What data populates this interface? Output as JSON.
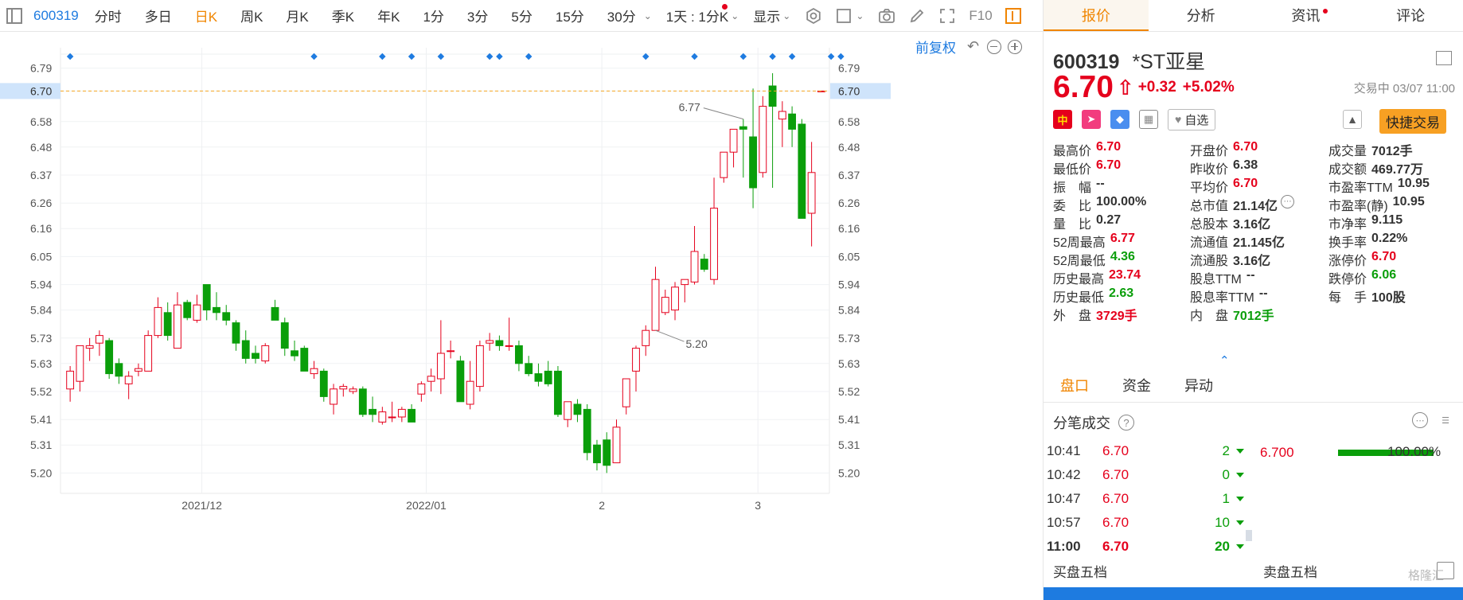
{
  "toolbar": {
    "code": "600319",
    "periods": [
      "分时",
      "多日",
      "日K",
      "周K",
      "月K",
      "季K",
      "年K",
      "1分",
      "3分",
      "5分",
      "15分",
      "30分"
    ],
    "active_period": "日K",
    "interval_label": "1天 : 1分K",
    "display_label": "显示",
    "f10_label": "F10"
  },
  "chart_controls": {
    "adjust_label": "前复权"
  },
  "chart_data": {
    "type": "candlestick",
    "y_ticks": [
      6.79,
      6.7,
      6.58,
      6.48,
      6.37,
      6.26,
      6.16,
      6.05,
      5.94,
      5.84,
      5.73,
      5.63,
      5.52,
      5.41,
      5.31,
      5.2
    ],
    "x_labels": [
      {
        "label": "2021/12",
        "index": 14
      },
      {
        "label": "2022/01",
        "index": 37
      },
      {
        "label": "2",
        "index": 55
      },
      {
        "label": "3",
        "index": 71
      }
    ],
    "ylim": [
      5.12,
      6.87
    ],
    "current_price": 6.7,
    "current_price_label": "6.70",
    "max_label": "6.77",
    "min_label": "5.20",
    "max_index": 69,
    "min_index": 60,
    "event_marker_indices": [
      0,
      25,
      32,
      35,
      38,
      43,
      44,
      47,
      59,
      64,
      69,
      72,
      74,
      78,
      79
    ],
    "candles": [
      {
        "o": 5.53,
        "h": 5.62,
        "l": 5.48,
        "c": 5.6
      },
      {
        "o": 5.56,
        "h": 5.7,
        "l": 5.52,
        "c": 5.7
      },
      {
        "o": 5.69,
        "h": 5.73,
        "l": 5.64,
        "c": 5.7
      },
      {
        "o": 5.71,
        "h": 5.76,
        "l": 5.66,
        "c": 5.74
      },
      {
        "o": 5.72,
        "h": 5.73,
        "l": 5.57,
        "c": 5.59
      },
      {
        "o": 5.63,
        "h": 5.65,
        "l": 5.55,
        "c": 5.58
      },
      {
        "o": 5.55,
        "h": 5.6,
        "l": 5.49,
        "c": 5.58
      },
      {
        "o": 5.6,
        "h": 5.63,
        "l": 5.58,
        "c": 5.61
      },
      {
        "o": 5.6,
        "h": 5.76,
        "l": 5.6,
        "c": 5.74
      },
      {
        "o": 5.74,
        "h": 5.89,
        "l": 5.73,
        "c": 5.85
      },
      {
        "o": 5.83,
        "h": 5.87,
        "l": 5.72,
        "c": 5.74
      },
      {
        "o": 5.69,
        "h": 5.91,
        "l": 5.69,
        "c": 5.86
      },
      {
        "o": 5.87,
        "h": 5.88,
        "l": 5.8,
        "c": 5.81
      },
      {
        "o": 5.8,
        "h": 5.9,
        "l": 5.79,
        "c": 5.86
      },
      {
        "o": 5.94,
        "h": 5.94,
        "l": 5.8,
        "c": 5.84
      },
      {
        "o": 5.85,
        "h": 5.91,
        "l": 5.8,
        "c": 5.83
      },
      {
        "o": 5.83,
        "h": 5.86,
        "l": 5.78,
        "c": 5.8
      },
      {
        "o": 5.79,
        "h": 5.8,
        "l": 5.68,
        "c": 5.71
      },
      {
        "o": 5.72,
        "h": 5.76,
        "l": 5.63,
        "c": 5.65
      },
      {
        "o": 5.67,
        "h": 5.7,
        "l": 5.63,
        "c": 5.65
      },
      {
        "o": 5.64,
        "h": 5.71,
        "l": 5.63,
        "c": 5.7
      },
      {
        "o": 5.85,
        "h": 5.88,
        "l": 5.8,
        "c": 5.8
      },
      {
        "o": 5.79,
        "h": 5.81,
        "l": 5.66,
        "c": 5.69
      },
      {
        "o": 5.68,
        "h": 5.72,
        "l": 5.64,
        "c": 5.66
      },
      {
        "o": 5.69,
        "h": 5.7,
        "l": 5.6,
        "c": 5.6
      },
      {
        "o": 5.59,
        "h": 5.64,
        "l": 5.57,
        "c": 5.61
      },
      {
        "o": 5.6,
        "h": 5.61,
        "l": 5.48,
        "c": 5.5
      },
      {
        "o": 5.47,
        "h": 5.55,
        "l": 5.43,
        "c": 5.53
      },
      {
        "o": 5.53,
        "h": 5.55,
        "l": 5.5,
        "c": 5.54
      },
      {
        "o": 5.52,
        "h": 5.54,
        "l": 5.51,
        "c": 5.53
      },
      {
        "o": 5.53,
        "h": 5.54,
        "l": 5.42,
        "c": 5.43
      },
      {
        "o": 5.45,
        "h": 5.5,
        "l": 5.4,
        "c": 5.43
      },
      {
        "o": 5.4,
        "h": 5.46,
        "l": 5.39,
        "c": 5.44
      },
      {
        "o": 5.42,
        "h": 5.48,
        "l": 5.4,
        "c": 5.42
      },
      {
        "o": 5.42,
        "h": 5.46,
        "l": 5.4,
        "c": 5.45
      },
      {
        "o": 5.45,
        "h": 5.47,
        "l": 5.41,
        "c": 5.4
      },
      {
        "o": 5.51,
        "h": 5.56,
        "l": 5.48,
        "c": 5.55
      },
      {
        "o": 5.56,
        "h": 5.61,
        "l": 5.52,
        "c": 5.58
      },
      {
        "o": 5.57,
        "h": 5.8,
        "l": 5.51,
        "c": 5.67
      },
      {
        "o": 5.68,
        "h": 5.72,
        "l": 5.65,
        "c": 5.68
      },
      {
        "o": 5.64,
        "h": 5.66,
        "l": 5.48,
        "c": 5.48
      },
      {
        "o": 5.47,
        "h": 5.64,
        "l": 5.45,
        "c": 5.56
      },
      {
        "o": 5.54,
        "h": 5.72,
        "l": 5.52,
        "c": 5.7
      },
      {
        "o": 5.71,
        "h": 5.75,
        "l": 5.68,
        "c": 5.72
      },
      {
        "o": 5.72,
        "h": 5.74,
        "l": 5.68,
        "c": 5.7
      },
      {
        "o": 5.7,
        "h": 5.81,
        "l": 5.68,
        "c": 5.7
      },
      {
        "o": 5.7,
        "h": 5.72,
        "l": 5.6,
        "c": 5.63
      },
      {
        "o": 5.63,
        "h": 5.66,
        "l": 5.58,
        "c": 5.59
      },
      {
        "o": 5.59,
        "h": 5.63,
        "l": 5.54,
        "c": 5.56
      },
      {
        "o": 5.6,
        "h": 5.64,
        "l": 5.54,
        "c": 5.55
      },
      {
        "o": 5.6,
        "h": 5.62,
        "l": 5.42,
        "c": 5.43
      },
      {
        "o": 5.41,
        "h": 5.48,
        "l": 5.38,
        "c": 5.48
      },
      {
        "o": 5.47,
        "h": 5.49,
        "l": 5.4,
        "c": 5.43
      },
      {
        "o": 5.45,
        "h": 5.47,
        "l": 5.25,
        "c": 5.28
      },
      {
        "o": 5.31,
        "h": 5.33,
        "l": 5.21,
        "c": 5.24
      },
      {
        "o": 5.33,
        "h": 5.36,
        "l": 5.2,
        "c": 5.23
      },
      {
        "o": 5.24,
        "h": 5.41,
        "l": 5.24,
        "c": 5.38
      },
      {
        "o": 5.46,
        "h": 5.57,
        "l": 5.43,
        "c": 5.57
      },
      {
        "o": 5.6,
        "h": 5.7,
        "l": 5.52,
        "c": 5.69
      },
      {
        "o": 5.7,
        "h": 5.78,
        "l": 5.66,
        "c": 5.76
      },
      {
        "o": 5.76,
        "h": 6.01,
        "l": 5.76,
        "c": 5.96
      },
      {
        "o": 5.83,
        "h": 5.92,
        "l": 5.82,
        "c": 5.89
      },
      {
        "o": 5.84,
        "h": 5.95,
        "l": 5.8,
        "c": 5.93
      },
      {
        "o": 5.94,
        "h": 5.95,
        "l": 5.87,
        "c": 5.96
      },
      {
        "o": 5.95,
        "h": 6.17,
        "l": 5.94,
        "c": 6.07
      },
      {
        "o": 6.04,
        "h": 6.06,
        "l": 5.99,
        "c": 6.0
      },
      {
        "o": 5.96,
        "h": 6.36,
        "l": 5.94,
        "c": 6.24
      },
      {
        "o": 6.36,
        "h": 6.45,
        "l": 6.34,
        "c": 6.46
      },
      {
        "o": 6.46,
        "h": 6.54,
        "l": 6.4,
        "c": 6.55
      },
      {
        "o": 6.56,
        "h": 6.59,
        "l": 6.36,
        "c": 6.55
      },
      {
        "o": 6.52,
        "h": 6.71,
        "l": 6.24,
        "c": 6.32
      },
      {
        "o": 6.38,
        "h": 6.68,
        "l": 6.36,
        "c": 6.64
      },
      {
        "o": 6.72,
        "h": 6.77,
        "l": 6.32,
        "c": 6.64
      },
      {
        "o": 6.59,
        "h": 6.66,
        "l": 6.48,
        "c": 6.62
      },
      {
        "o": 6.61,
        "h": 6.64,
        "l": 6.48,
        "c": 6.55
      },
      {
        "o": 6.57,
        "h": 6.59,
        "l": 6.2,
        "c": 6.2
      },
      {
        "o": 6.22,
        "h": 6.5,
        "l": 6.09,
        "c": 6.38
      },
      {
        "o": 6.7,
        "h": 6.7,
        "l": 6.7,
        "c": 6.7
      }
    ]
  },
  "panel": {
    "tabs": [
      {
        "label": "报价",
        "active": true,
        "dot": false
      },
      {
        "label": "分析",
        "active": false,
        "dot": false
      },
      {
        "label": "资讯",
        "active": false,
        "dot": true
      },
      {
        "label": "评论",
        "active": false,
        "dot": false
      }
    ],
    "code": "600319",
    "name": "*ST亚星",
    "price": "6.70",
    "change": "+0.32",
    "change_pct": "+5.02%",
    "trade_status": "交易中 03/07 11:00",
    "icons": {
      "cn_badge": "中",
      "fav_label": "自选",
      "quick_trade_label": "快捷交易"
    },
    "stats": [
      {
        "label": "最高价",
        "value": "6.70",
        "color": "red"
      },
      {
        "label": "开盘价",
        "value": "6.70",
        "color": "red"
      },
      {
        "label": "成交量",
        "value": "7012手",
        "color": "dark"
      },
      {
        "label": "最低价",
        "value": "6.70",
        "color": "red"
      },
      {
        "label": "昨收价",
        "value": "6.38",
        "color": "dark"
      },
      {
        "label": "成交额",
        "value": "469.77万",
        "color": "dark"
      },
      {
        "label": "振　幅",
        "value": "--",
        "color": "dark"
      },
      {
        "label": "平均价",
        "value": "6.70",
        "color": "red"
      },
      {
        "label": "市盈率TTM",
        "value": "10.95",
        "color": "dark"
      },
      {
        "label": "委　比",
        "value": "100.00%",
        "color": "dark"
      },
      {
        "label": "总市值",
        "value": "21.14亿",
        "color": "dark",
        "more": true
      },
      {
        "label": "市盈率(静)",
        "value": "10.95",
        "color": "dark"
      },
      {
        "label": "量　比",
        "value": "0.27",
        "color": "dark"
      },
      {
        "label": "总股本",
        "value": "3.16亿",
        "color": "dark"
      },
      {
        "label": "市净率",
        "value": "9.115",
        "color": "dark"
      },
      {
        "label": "52周最高",
        "value": "6.77",
        "color": "red"
      },
      {
        "label": "流通值",
        "value": "21.145亿",
        "color": "dark"
      },
      {
        "label": "换手率",
        "value": "0.22%",
        "color": "dark"
      },
      {
        "label": "52周最低",
        "value": "4.36",
        "color": "green"
      },
      {
        "label": "流通股",
        "value": "3.16亿",
        "color": "dark"
      },
      {
        "label": "涨停价",
        "value": "6.70",
        "color": "red"
      },
      {
        "label": "历史最高",
        "value": "23.74",
        "color": "red"
      },
      {
        "label": "股息TTM",
        "value": "--",
        "color": "dark"
      },
      {
        "label": "跌停价",
        "value": "6.06",
        "color": "green"
      },
      {
        "label": "历史最低",
        "value": "2.63",
        "color": "green"
      },
      {
        "label": "股息率TTM",
        "value": "--",
        "color": "dark"
      },
      {
        "label": "每　手",
        "value": "100股",
        "color": "dark"
      },
      {
        "label": "外　盘",
        "value": "3729手",
        "color": "red"
      },
      {
        "label": "内　盘",
        "value": "7012手",
        "color": "green"
      },
      {
        "label": "",
        "value": "",
        "color": "dark"
      }
    ],
    "sub_tabs": [
      {
        "label": "盘口",
        "active": true
      },
      {
        "label": "资金",
        "active": false
      },
      {
        "label": "异动",
        "active": false
      }
    ],
    "ticks_title": "分笔成交",
    "ticks": [
      {
        "time": "10:41",
        "price": "6.70",
        "vol": "2"
      },
      {
        "time": "10:42",
        "price": "6.70",
        "vol": "0"
      },
      {
        "time": "10:47",
        "price": "6.70",
        "vol": "1"
      },
      {
        "time": "10:57",
        "price": "6.70",
        "vol": "10"
      },
      {
        "time": "11:00",
        "price": "6.70",
        "vol": "20",
        "bold": true
      }
    ],
    "price_dist": {
      "price": "6.700",
      "pct": "100.00%",
      "fraction": 1.0
    },
    "bid_title": "买盘五档",
    "ask_title": "卖盘五档",
    "watermark": "格隆汇"
  }
}
